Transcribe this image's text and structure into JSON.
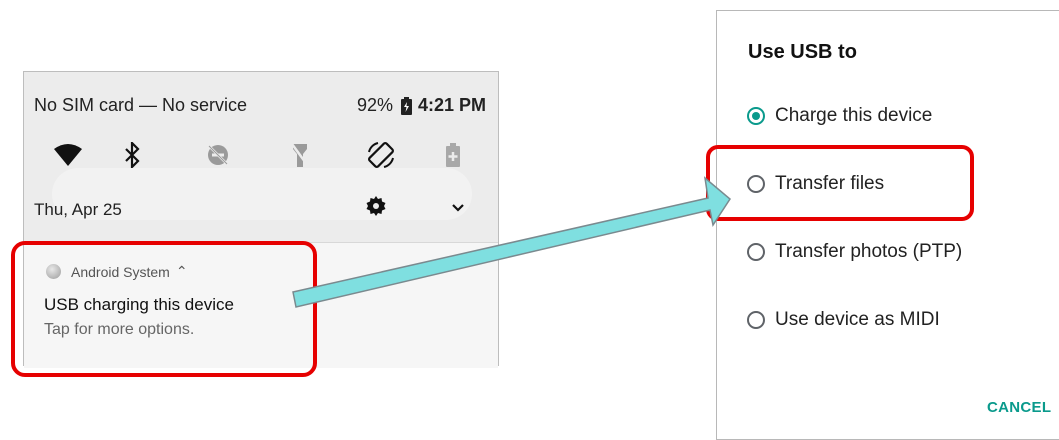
{
  "status_bar": {
    "carrier": "No SIM card — No service",
    "battery_percent": "92%",
    "time": "4:21 PM"
  },
  "quick_settings": {
    "icons": [
      "wifi-icon",
      "bluetooth-icon",
      "dnd-off-icon",
      "flashlight-off-icon",
      "auto-rotate-icon",
      "battery-saver-icon"
    ]
  },
  "date_row": {
    "date": "Thu, Apr 25"
  },
  "notification": {
    "app_name": "Android System",
    "expand_glyph": "⌃",
    "title": "USB charging this device",
    "subtitle": "Tap for more options."
  },
  "dialog": {
    "title": "Use USB to",
    "options": [
      {
        "label": "Charge this device",
        "selected": true
      },
      {
        "label": "Transfer files",
        "selected": false
      },
      {
        "label": "Transfer photos (PTP)",
        "selected": false
      },
      {
        "label": "Use device as MIDI",
        "selected": false
      }
    ],
    "cancel_label": "CANCEL"
  },
  "colors": {
    "accent": "#0a9a8c",
    "callout": "#e60000",
    "arrow_fill": "#7fdfe0"
  }
}
